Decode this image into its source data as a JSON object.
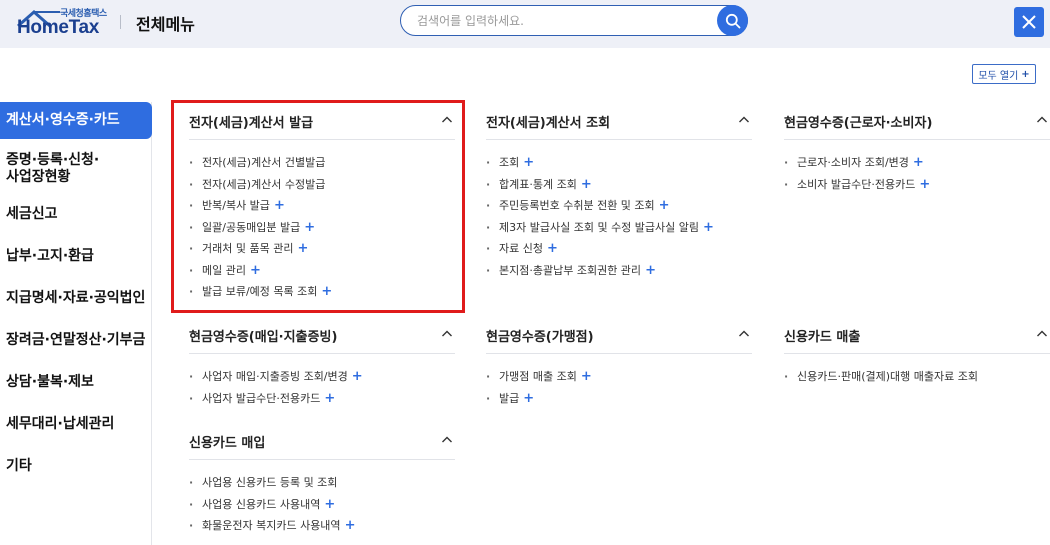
{
  "header": {
    "logo_sub": "국세청홈택스",
    "logo_main": "HomeTax",
    "title": "전체메뉴",
    "search_placeholder": "검색어를 입력하세요.",
    "accent_color": "#2f6de0"
  },
  "expand_all": {
    "label": "모두 열기",
    "icon": "+"
  },
  "sidebar": {
    "items": [
      {
        "label": "계산서·영수증·카드",
        "active": true
      },
      {
        "label": "증명·등록·신청·",
        "label2": "사업장현황"
      },
      {
        "label": "세금신고"
      },
      {
        "label": "납부·고지·환급"
      },
      {
        "label": "지급명세·자료·공익법인"
      },
      {
        "label": "장려금·연말정산·기부금"
      },
      {
        "label": "상담·불복·제보"
      },
      {
        "label": "세무대리·납세관리"
      },
      {
        "label": "기타"
      }
    ]
  },
  "sections": [
    {
      "title": "전자(세금)계산서 발급",
      "items": [
        {
          "label": "전자(세금)계산서 건별발급",
          "expand": false
        },
        {
          "label": "전자(세금)계산서 수정발급",
          "expand": false
        },
        {
          "label": "반복/복사 발급",
          "expand": true
        },
        {
          "label": "일괄/공동매입분 발급",
          "expand": true
        },
        {
          "label": "거래처 및 품목 관리",
          "expand": true
        },
        {
          "label": "메일 관리",
          "expand": true
        },
        {
          "label": "발급 보류/예정 목록 조회",
          "expand": true
        }
      ]
    },
    {
      "title": "전자(세금)계산서 조회",
      "items": [
        {
          "label": "조회",
          "expand": true
        },
        {
          "label": "합계표·통계 조회",
          "expand": true
        },
        {
          "label": "주민등록번호 수취분 전환 및 조회",
          "expand": true
        },
        {
          "label": "제3자 발급사실 조회 및 수정 발급사실 알림",
          "expand": true
        },
        {
          "label": "자료 신청",
          "expand": true
        },
        {
          "label": "본지점·총괄납부 조회권한 관리",
          "expand": true
        }
      ]
    },
    {
      "title": "현금영수증(근로자·소비자)",
      "items": [
        {
          "label": "근로자·소비자 조회/변경",
          "expand": true
        },
        {
          "label": "소비자 발급수단·전용카드",
          "expand": true
        }
      ]
    },
    {
      "title": "현금영수증(매입·지출증빙)",
      "items": [
        {
          "label": "사업자 매입·지출증빙 조회/변경",
          "expand": true
        },
        {
          "label": "사업자 발급수단·전용카드",
          "expand": true
        }
      ]
    },
    {
      "title": "현금영수증(가맹점)",
      "items": [
        {
          "label": "가맹점 매출 조회",
          "expand": true
        },
        {
          "label": "발급",
          "expand": true
        }
      ]
    },
    {
      "title": "신용카드 매출",
      "items": [
        {
          "label": "신용카드·판매(결제)대행 매출자료 조회",
          "expand": false
        }
      ]
    },
    {
      "title": "신용카드 매입",
      "items": [
        {
          "label": "사업용 신용카드 등록 및 조회",
          "expand": false
        },
        {
          "label": "사업용 신용카드 사용내역",
          "expand": true
        },
        {
          "label": "화물운전자 복지카드 사용내역",
          "expand": true
        }
      ]
    }
  ]
}
